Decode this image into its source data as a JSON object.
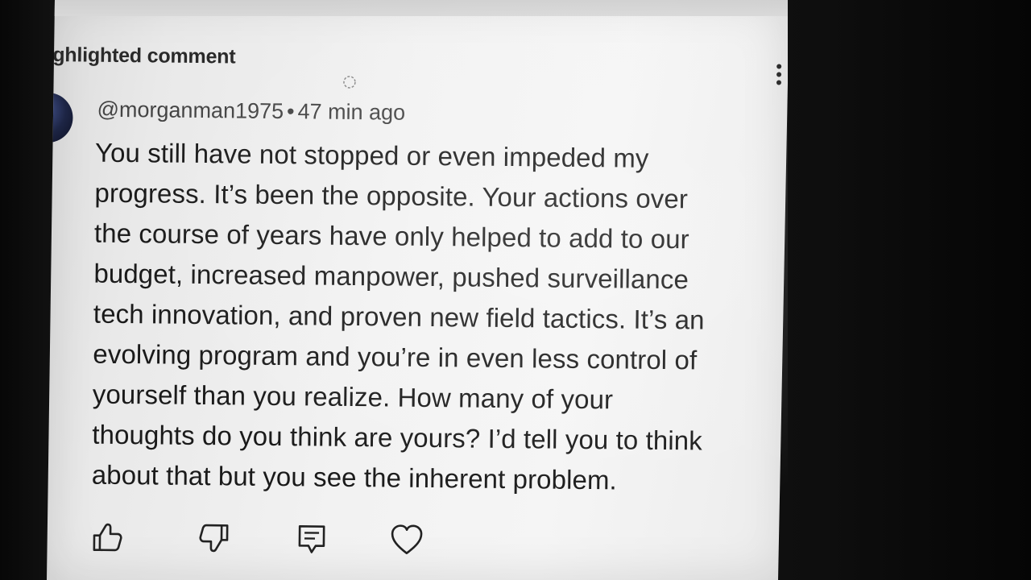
{
  "comment_section": {
    "header_label": "ghlighted comment"
  },
  "comment": {
    "author": "@morganman1975",
    "separator": "•",
    "time_ago": "47 min ago",
    "body_lines": [
      "You still have not stopped or even impeded my",
      "progress. It’s been the opposite. Your actions over",
      "the course of years have only helped to add to our",
      "budget, increased manpower, pushed surveillance",
      "tech innovation, and proven new field tactics. It’s an",
      "evolving program and you’re in even less control of",
      "yourself than you realize. How many of your",
      "thoughts do you think are yours? I’d tell you to think",
      "about that but you see the inherent problem."
    ]
  },
  "icons": {
    "more": "more-vertical-icon",
    "loading": "loading-spinner-icon",
    "like": "thumbs-up-icon",
    "dislike": "thumbs-down-icon",
    "reply": "reply-comment-icon",
    "heart": "heart-icon"
  },
  "colors": {
    "text": "#1a1a1a",
    "meta": "#444444",
    "screen_bg": "#f2f2f2",
    "surround": "#111111"
  }
}
